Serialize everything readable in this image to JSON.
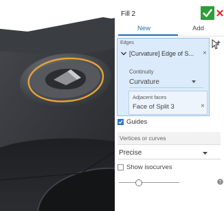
{
  "feature": {
    "title": "Fill 2",
    "tabs": [
      {
        "label": "New",
        "active": true
      },
      {
        "label": "Add",
        "active": false
      }
    ]
  },
  "edges": {
    "label": "Edges",
    "item_text": "[Curvature] Edge of S...",
    "continuity_label": "Continuity",
    "continuity_value": "Curvature",
    "adjacent_label": "Adjacent faces",
    "adjacent_value": "Face of Split 3"
  },
  "guides": {
    "label": "Guides",
    "checked": true
  },
  "vertices": {
    "placeholder": "Vertices or curves"
  },
  "mode": {
    "value": "Precise"
  },
  "isocurves": {
    "label": "Show isocurves",
    "checked": false
  },
  "slider": {
    "fraction": 0.31
  },
  "icons": {
    "ok": "check-icon",
    "cancel": "close-icon",
    "expand": "chevron-down-icon",
    "remove": "close-icon",
    "dropdown": "caret-down-icon",
    "cursor": "selection-cursor-icon",
    "help": "help-icon"
  },
  "colors": {
    "accent_blue": "#1f6fb8",
    "confirm_green": "#2e9e3a",
    "cancel_red": "#d92b2b",
    "selection_box": "#dcebfb",
    "model_body": "#2d2f33",
    "edge_highlight": "#e8a23a"
  }
}
